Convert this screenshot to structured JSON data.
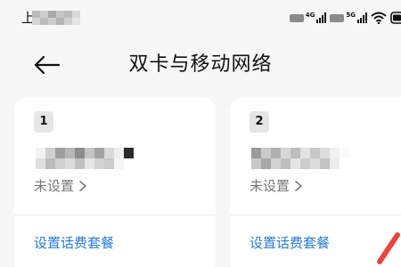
{
  "status_bar": {
    "time_prefix": "上",
    "net_type_1": "4G",
    "net_type_2": "5G"
  },
  "header": {
    "title": "双卡与移动网络"
  },
  "sim_cards": [
    {
      "slot": "1",
      "status": "未设置",
      "plan_link": "设置话费套餐"
    },
    {
      "slot": "2",
      "status": "未设置",
      "plan_link": "设置话费套餐"
    }
  ],
  "colors": {
    "link": "#2a7bd6",
    "card_bg": "#ffffff",
    "page_bg": "#f7f7f7",
    "accent_red": "#e8453c"
  }
}
